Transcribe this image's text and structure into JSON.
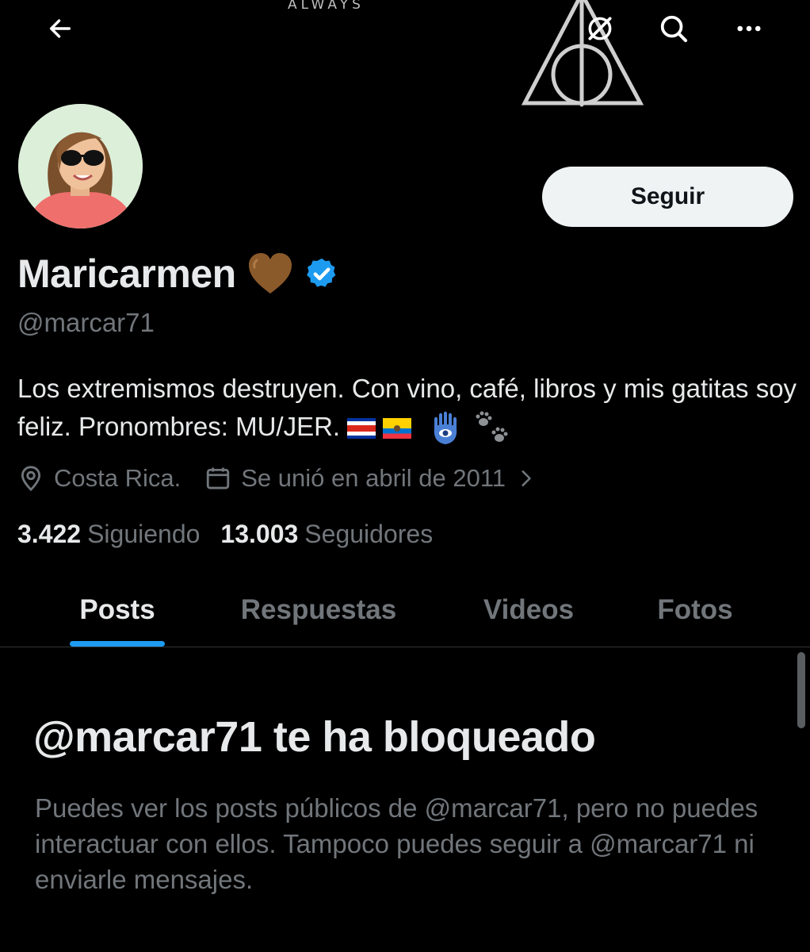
{
  "banner": {
    "text": "ALWAYS"
  },
  "topbar": {
    "back_icon": "arrow-left-icon",
    "grok_icon": "grok-icon",
    "search_icon": "search-icon",
    "more_icon": "more-horizontal-icon"
  },
  "profile": {
    "display_name": "Maricarmen",
    "name_emoji": "brown-heart",
    "verified_icon": "verified-badge-icon",
    "handle": "@marcar71",
    "follow_label": "Seguir",
    "bio_text": "Los extremismos destruyen. Con vino, café, libros y mis gatitas soy feliz. Pronombres: MU/JER.",
    "bio_emojis": [
      "costa-rica-flag",
      "ecuador-flag",
      "hamsa",
      "paw-prints"
    ],
    "location": "Costa Rica.",
    "joined": "Se unió en abril de 2011",
    "following_count": "3.422",
    "following_label": "Siguiendo",
    "followers_count": "13.003",
    "followers_label": "Seguidores"
  },
  "tabs": [
    {
      "label": "Posts",
      "active": true
    },
    {
      "label": "Respuestas",
      "active": false
    },
    {
      "label": "Videos",
      "active": false
    },
    {
      "label": "Fotos",
      "active": false
    }
  ],
  "blocked": {
    "title": "@marcar71 te ha bloqueado",
    "message": "Puedes ver los posts públicos de @marcar71, pero no puedes interactuar con ellos. Tampoco puedes seguir a @marcar71 ni enviarle mensajes."
  },
  "colors": {
    "background": "#000000",
    "accent": "#1d9bf0",
    "text_primary": "#e7e9ea",
    "text_secondary": "#71767b",
    "button_bg": "#eff3f4"
  }
}
